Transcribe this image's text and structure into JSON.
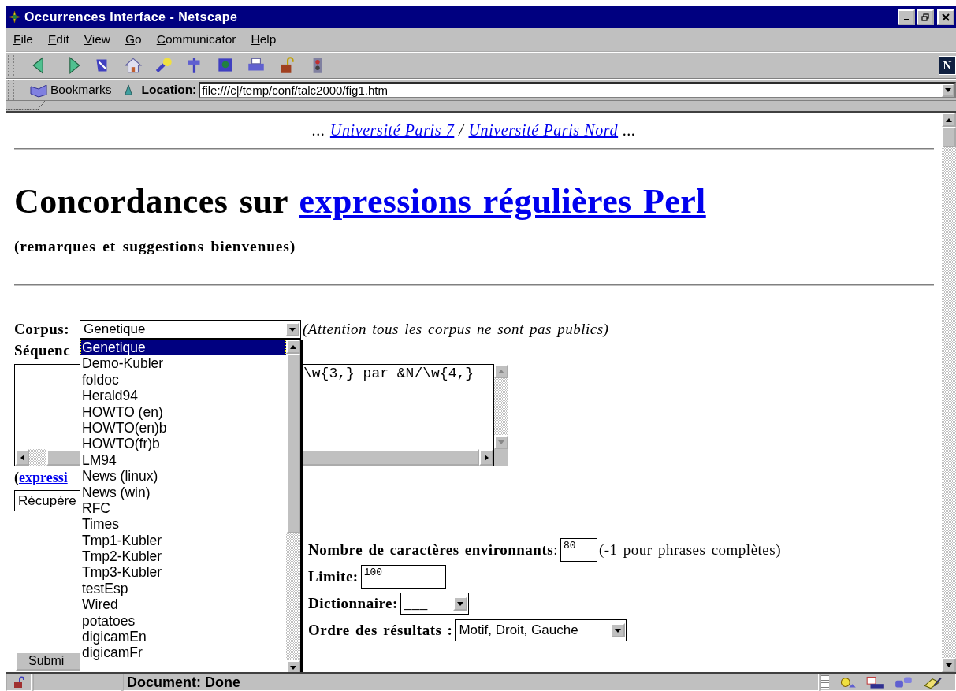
{
  "window": {
    "title": "Occurrences Interface - Netscape"
  },
  "menu": [
    {
      "label": "File"
    },
    {
      "label": "Edit"
    },
    {
      "label": "View"
    },
    {
      "label": "Go"
    },
    {
      "label": "Communicator"
    },
    {
      "label": "Help"
    }
  ],
  "throbber": {
    "letter": "N"
  },
  "location_bar": {
    "bookmarks": "Bookmarks",
    "label": "Location:",
    "url": "file:///c|/temp/conf/talc2000/fig1.htm"
  },
  "header": {
    "lead": "...",
    "links": [
      "Université Paris 7",
      "Université Paris Nord"
    ],
    "separator": "/",
    "trail": "..."
  },
  "heading": {
    "text": "Concordances sur",
    "link": "expressions régulières Perl"
  },
  "subtitle": "(remarques et suggestions bienvenues)",
  "corpus": {
    "label": "Corpus:",
    "value": "Genetique",
    "note": "(Attention tous les corpus ne sont pas publics)",
    "expanded": true,
    "options": [
      {
        "label": "Genetique",
        "selected": true
      },
      {
        "label": "Demo-Kubler",
        "selected": false
      },
      {
        "label": "foldoc",
        "selected": false
      },
      {
        "label": "Herald94",
        "selected": false
      },
      {
        "label": "HOWTO (en)",
        "selected": false
      },
      {
        "label": "HOWTO(en)b",
        "selected": false
      },
      {
        "label": "HOWTO(fr)b",
        "selected": false
      },
      {
        "label": "LM94",
        "selected": false
      },
      {
        "label": "News (linux)",
        "selected": false
      },
      {
        "label": "News (win)",
        "selected": false
      },
      {
        "label": "RFC",
        "selected": false
      },
      {
        "label": "Times",
        "selected": false
      },
      {
        "label": "Tmp1-Kubler",
        "selected": false
      },
      {
        "label": "Tmp2-Kubler",
        "selected": false
      },
      {
        "label": "Tmp3-Kubler",
        "selected": false
      },
      {
        "label": "testEsp",
        "selected": false
      },
      {
        "label": "Wired",
        "selected": false
      },
      {
        "label": "potatoes",
        "selected": false
      },
      {
        "label": "digicamEn",
        "selected": false
      },
      {
        "label": "digicamFr",
        "selected": false
      }
    ]
  },
  "sequence": {
    "label": "Séquenc",
    "value": "\\w{3,} par &N/\\w{4,}"
  },
  "help": {
    "paren": "(",
    "link": "expressi"
  },
  "retrieve": {
    "value": "Récupére"
  },
  "context": {
    "label": "**Nombre de caractères environnants**:",
    "value": "80",
    "hint": "(-1 pour phrases complètes)"
  },
  "limit": {
    "label": "Limite:",
    "value": "100"
  },
  "dictionary": {
    "label": "Dictionnaire:",
    "value": "___"
  },
  "order": {
    "label": "Ordre des résultats :",
    "value": "Motif, Droit, Gauche"
  },
  "submit": {
    "label": "Submi"
  },
  "status_bar": {
    "text": "Document: Done"
  }
}
